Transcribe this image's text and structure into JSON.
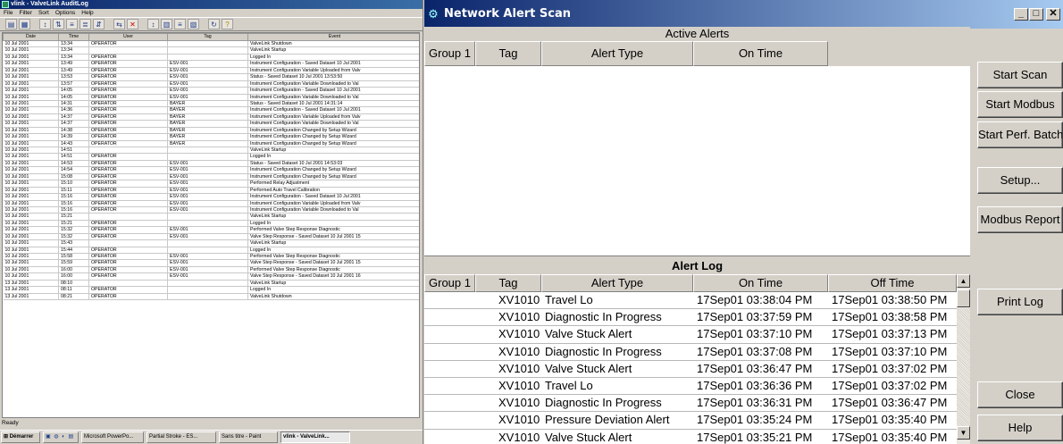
{
  "audit_window": {
    "title": "vlink - ValveLink AuditLog",
    "menu": [
      "File",
      "Filter",
      "Sort",
      "Options",
      "Help"
    ],
    "columns": [
      "Date",
      "Time",
      "User",
      "Tag",
      "Event"
    ],
    "rows": [
      [
        "10 Jul 2001",
        "13:34",
        "OPERATOR",
        "",
        "ValveLink Shutdown"
      ],
      [
        "10 Jul 2001",
        "13:34",
        "",
        "",
        "ValveLink Startup"
      ],
      [
        "10 Jul 2001",
        "13:34",
        "OPERATOR",
        "",
        "Logged In"
      ],
      [
        "10 Jul 2001",
        "13:49",
        "OPERATOR",
        "ESV-001",
        "Instrument Configuration - Saved Dataset 10 Jul 2001"
      ],
      [
        "10 Jul 2001",
        "13:49",
        "OPERATOR",
        "ESV-001",
        "Instrument Configuration Variable Uploaded from Valv"
      ],
      [
        "10 Jul 2001",
        "13:53",
        "OPERATOR",
        "ESV-001",
        "Status - Saved Dataset 10 Jul 2001 13:53:50"
      ],
      [
        "10 Jul 2001",
        "13:57",
        "OPERATOR",
        "ESV-001",
        "Instrument Configuration Variable Downloaded to Val"
      ],
      [
        "10 Jul 2001",
        "14:05",
        "OPERATOR",
        "ESV-001",
        "Instrument Configuration - Saved Dataset 10 Jul 2001"
      ],
      [
        "10 Jul 2001",
        "14:05",
        "OPERATOR",
        "ESV-001",
        "Instrument Configuration Variable Downloaded to Val"
      ],
      [
        "10 Jul 2001",
        "14:31",
        "OPERATOR",
        "BAYER",
        "Status - Saved Dataset 10 Jul 2001 14:31:14"
      ],
      [
        "10 Jul 2001",
        "14:36",
        "OPERATOR",
        "BAYER",
        "Instrument Configuration - Saved Dataset 10 Jul 2001"
      ],
      [
        "10 Jul 2001",
        "14:37",
        "OPERATOR",
        "BAYER",
        "Instrument Configuration Variable Uploaded from Valv"
      ],
      [
        "10 Jul 2001",
        "14:37",
        "OPERATOR",
        "BAYER",
        "Instrument Configuration Variable Downloaded to Val"
      ],
      [
        "10 Jul 2001",
        "14:38",
        "OPERATOR",
        "BAYER",
        "Instrument Configuration Changed by Setup Wizard"
      ],
      [
        "10 Jul 2001",
        "14:39",
        "OPERATOR",
        "BAYER",
        "Instrument Configuration Changed by Setup Wizard"
      ],
      [
        "10 Jul 2001",
        "14:43",
        "OPERATOR",
        "BAYER",
        "Instrument Configuration Changed by Setup Wizard"
      ],
      [
        "10 Jul 2001",
        "14:51",
        "",
        "",
        "ValveLink Startup"
      ],
      [
        "10 Jul 2001",
        "14:51",
        "OPERATOR",
        "",
        "Logged In"
      ],
      [
        "10 Jul 2001",
        "14:53",
        "OPERATOR",
        "ESV-001",
        "Status - Saved Dataset 10 Jul 2001 14:53:03"
      ],
      [
        "10 Jul 2001",
        "14:54",
        "OPERATOR",
        "ESV-001",
        "Instrument Configuration Changed by Setup Wizard"
      ],
      [
        "10 Jul 2001",
        "15:08",
        "OPERATOR",
        "ESV-001",
        "Instrument Configuration Changed by Setup Wizard"
      ],
      [
        "10 Jul 2001",
        "15:10",
        "OPERATOR",
        "ESV-001",
        "Performed Relay Adjustment"
      ],
      [
        "10 Jul 2001",
        "15:11",
        "OPERATOR",
        "ESV-001",
        "Performed Auto Travel Calibration"
      ],
      [
        "10 Jul 2001",
        "15:16",
        "OPERATOR",
        "ESV-001",
        "Instrument Configuration - Saved Dataset 10 Jul 2001"
      ],
      [
        "10 Jul 2001",
        "15:16",
        "OPERATOR",
        "ESV-001",
        "Instrument Configuration Variable Uploaded from Valv"
      ],
      [
        "10 Jul 2001",
        "15:16",
        "OPERATOR",
        "ESV-001",
        "Instrument Configuration Variable Downloaded to Val"
      ],
      [
        "10 Jul 2001",
        "15:21",
        "",
        "",
        "ValveLink Startup"
      ],
      [
        "10 Jul 2001",
        "15:21",
        "OPERATOR",
        "",
        "Logged In"
      ],
      [
        "10 Jul 2001",
        "15:32",
        "OPERATOR",
        "ESV-001",
        "Performed Valve Step Response Diagnostic"
      ],
      [
        "10 Jul 2001",
        "15:32",
        "OPERATOR",
        "ESV-001",
        "Valve Step Response - Saved Dataset 10 Jul 2001 15"
      ],
      [
        "10 Jul 2001",
        "15:43",
        "",
        "",
        "ValveLink Startup"
      ],
      [
        "10 Jul 2001",
        "15:44",
        "OPERATOR",
        "",
        "Logged In"
      ],
      [
        "10 Jul 2001",
        "15:58",
        "OPERATOR",
        "ESV-001",
        "Performed Valve Step Response Diagnostic"
      ],
      [
        "10 Jul 2001",
        "15:59",
        "OPERATOR",
        "ESV-001",
        "Valve Step Response - Saved Dataset 10 Jul 2001 15"
      ],
      [
        "10 Jul 2001",
        "16:00",
        "OPERATOR",
        "ESV-001",
        "Performed Valve Step Response Diagnostic"
      ],
      [
        "10 Jul 2001",
        "16:00",
        "OPERATOR",
        "ESV-001",
        "Valve Step Response - Saved Dataset 10 Jul 2001 16"
      ],
      [
        "13 Jul 2001",
        "08:10",
        "",
        "",
        "ValveLink Startup"
      ],
      [
        "13 Jul 2001",
        "08:11",
        "OPERATOR",
        "",
        "Logged In"
      ],
      [
        "13 Jul 2001",
        "08:21",
        "OPERATOR",
        "",
        "ValveLink Shutdown"
      ]
    ],
    "status": "Ready",
    "taskbar": {
      "start_label": "Démarrer",
      "items": [
        "Microsoft PowerPo...",
        "Partial Stroke - ES...",
        "Sans titre - Paint",
        "vlink - ValveLink..."
      ]
    }
  },
  "alert_window": {
    "title": "Network Alert Scan",
    "controls": {
      "minimize": "_",
      "maximize": "□",
      "close": "✕"
    },
    "active_alerts": {
      "title": "Active Alerts",
      "columns": [
        "Group 1",
        "Tag",
        "Alert Type",
        "On Time"
      ]
    },
    "alert_log": {
      "title": "Alert Log",
      "columns": [
        "Group 1",
        "Tag",
        "Alert Type",
        "On Time",
        "Off Time"
      ],
      "rows": [
        [
          "",
          "XV1010",
          "Travel Lo",
          "17Sep01 03:38:04 PM",
          "17Sep01 03:38:50 PM"
        ],
        [
          "",
          "XV1010",
          "Diagnostic In Progress",
          "17Sep01 03:37:59 PM",
          "17Sep01 03:38:58 PM"
        ],
        [
          "",
          "XV1010",
          "Valve Stuck Alert",
          "17Sep01 03:37:10 PM",
          "17Sep01 03:37:13 PM"
        ],
        [
          "",
          "XV1010",
          "Diagnostic In Progress",
          "17Sep01 03:37:08 PM",
          "17Sep01 03:37:10 PM"
        ],
        [
          "",
          "XV1010",
          "Valve Stuck Alert",
          "17Sep01 03:36:47 PM",
          "17Sep01 03:37:02 PM"
        ],
        [
          "",
          "XV1010",
          "Travel Lo",
          "17Sep01 03:36:36 PM",
          "17Sep01 03:37:02 PM"
        ],
        [
          "",
          "XV1010",
          "Diagnostic In Progress",
          "17Sep01 03:36:31 PM",
          "17Sep01 03:36:47 PM"
        ],
        [
          "",
          "XV1010",
          "Pressure Deviation Alert",
          "17Sep01 03:35:24 PM",
          "17Sep01 03:35:40 PM"
        ],
        [
          "",
          "XV1010",
          "Valve Stuck Alert",
          "17Sep01 03:35:21 PM",
          "17Sep01 03:35:40 PM"
        ]
      ]
    },
    "buttons": {
      "start_scan": "Start Scan",
      "start_modbus": "Start Modbus",
      "start_perf_batch": "Start Perf. Batch",
      "setup": "Setup...",
      "modbus_report": "Modbus Report",
      "print_log": "Print Log",
      "close": "Close",
      "help": "Help"
    }
  }
}
